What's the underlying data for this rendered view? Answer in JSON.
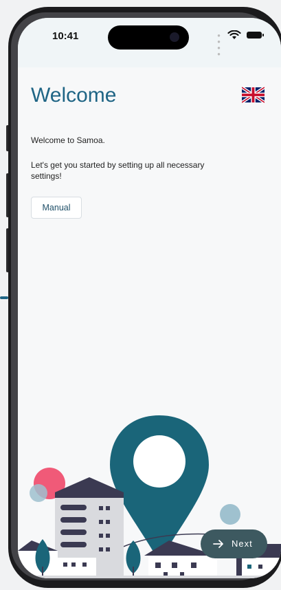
{
  "status_bar": {
    "time": "10:41"
  },
  "header": {
    "title": "Welcome",
    "language_icon": "uk-flag-icon"
  },
  "content": {
    "greeting": "Welcome to Samoa.",
    "intro_line1": "Let's get you started by setting up all necessary",
    "intro_line2": "settings!",
    "manual_label": "Manual"
  },
  "footer": {
    "next_label": "Next",
    "next_icon": "arrow-right-icon"
  },
  "colors": {
    "accent": "#1f6585",
    "pin": "#1a6579",
    "button_dark": "#3d5960",
    "building_dark": "#3b3a52",
    "pink": "#f05a78",
    "light_blue": "#9fc1cf"
  }
}
